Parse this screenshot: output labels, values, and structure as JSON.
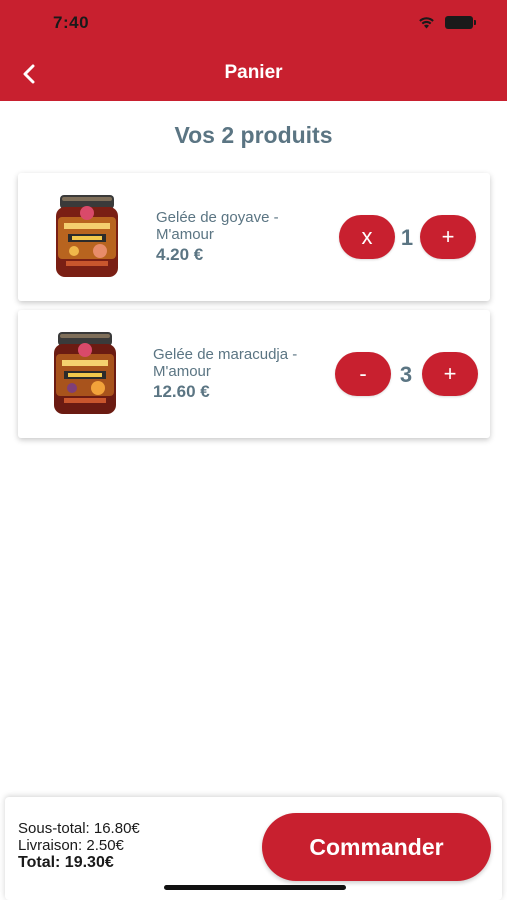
{
  "status_bar": {
    "time": "7:40",
    "icons": [
      "wifi-icon",
      "battery-icon"
    ]
  },
  "header": {
    "title": "Panier",
    "back_icon": "chevron-left-icon"
  },
  "page_title": "Vos 2 produits",
  "items": [
    {
      "name": "Gelée de goyave - M'amour",
      "price": "4.20 €",
      "quantity": "1",
      "decrement_label": "x",
      "increment_label": "+",
      "image": "jar-goyave"
    },
    {
      "name": "Gelée de maracudja - M'amour",
      "price": "12.60 €",
      "quantity": "3",
      "decrement_label": "-",
      "increment_label": "+",
      "image": "jar-maracudja"
    }
  ],
  "summary": {
    "subtotal": "Sous-total: 16.80€",
    "delivery": "Livraison: 2.50€",
    "total": "Total: 19.30€"
  },
  "order_button": "Commander",
  "colors": {
    "brand_red": "#c8202f",
    "text_slate": "#5b7583"
  }
}
